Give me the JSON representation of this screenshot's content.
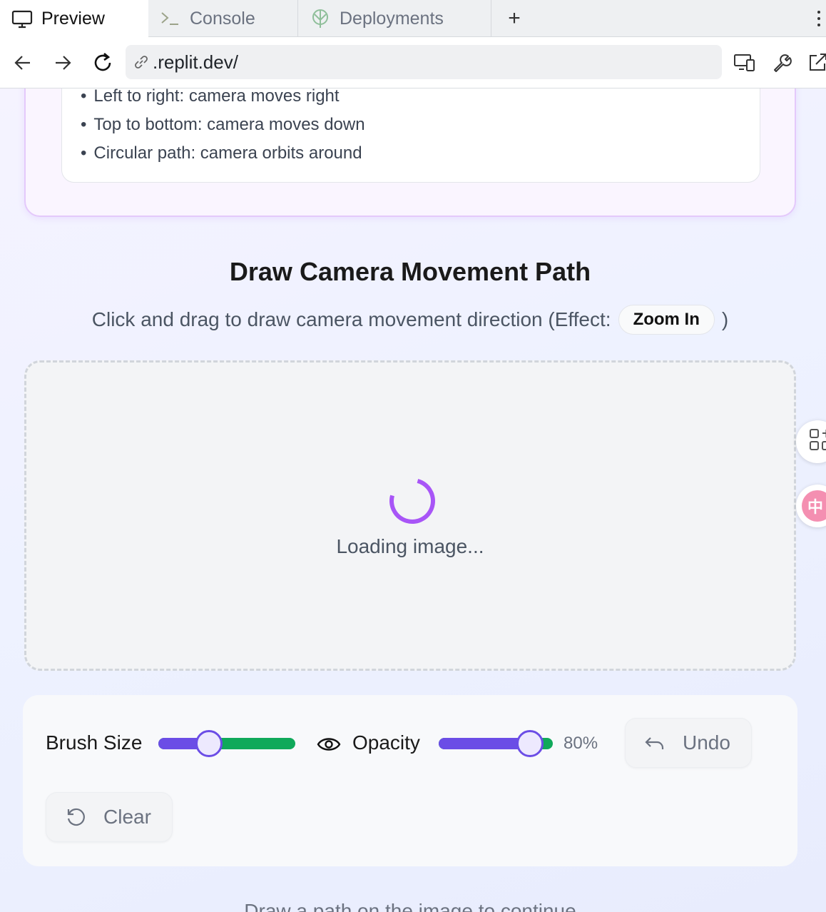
{
  "tabs": {
    "preview": "Preview",
    "console": "Console",
    "deployments": "Deployments",
    "add_icon": "+"
  },
  "url": {
    "text": ".replit.dev/"
  },
  "info": {
    "items": [
      "Left to right: camera moves right",
      "Top to bottom: camera moves down",
      "Circular path: camera orbits around"
    ]
  },
  "section": {
    "title": "Draw Camera Movement Path",
    "instruction_prefix": "Click and drag to draw camera movement direction (Effect:",
    "effect": "Zoom In",
    "instruction_suffix": ")"
  },
  "canvas": {
    "loading": "Loading image..."
  },
  "controls": {
    "brush_label": "Brush Size",
    "brush_level": 0.37,
    "opacity_label": "Opacity",
    "opacity_level": 0.8,
    "opacity_value": "80%",
    "undo_label": "Undo",
    "clear_label": "Clear"
  },
  "side": {
    "translate_glyph": "中"
  },
  "hint": "Draw a path on the image to continue",
  "colors": {
    "accent": "#6b4de6",
    "slider_track": "#10a95a",
    "spinner": "#a855f7"
  }
}
